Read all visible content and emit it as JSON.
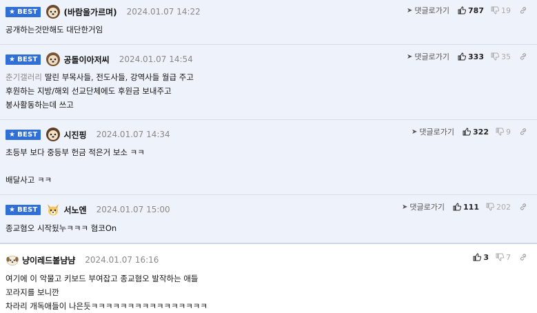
{
  "best_label": "BEST",
  "reply_label": "댓글로가기",
  "comments": [
    {
      "nickname": "(바람을가르며)",
      "date": "2024.01.07 14:22",
      "up": "787",
      "down": "19",
      "lines": [
        "공개하는것만해도 대단한거임"
      ]
    },
    {
      "nickname": "공돌이아저씨",
      "date": "2024.01.07 14:54",
      "up": "333",
      "down": "35",
      "prefix": "춘기갤러리",
      "lines": [
        "딸린 부목사들, 전도사들, 강역사들 월급 주고",
        "후원하는 지방/해외 선교단체에도 후원금 보내주고",
        "봉사활동하는데 쓰고"
      ]
    },
    {
      "nickname": "시진핑",
      "date": "2024.01.07 14:34",
      "up": "322",
      "down": "9",
      "lines": [
        "초등부 보다 중등부 헌금 적은거 보소 ㅋㅋ",
        "",
        "배달사고 ㅋㅋ"
      ]
    },
    {
      "nickname": "서노엔",
      "date": "2024.01.07 15:00",
      "up": "111",
      "down": "202",
      "lines": [
        "종교혐오 시작됬누ㅋㅋㅋ 혐코On"
      ]
    },
    {
      "nickname": "냥이레드볼냠냠",
      "date": "2024.01.07 16:16",
      "up": "3",
      "down": "7",
      "lines": [
        "여기에 이 악물고 키보드 부여잡고 종교혐오 발작하는 애들",
        "꼬라지를 보니깐",
        "차라리 개독애들이 나은듯ㅋㅋㅋㅋㅋㅋㅋㅋㅋㅋㅋㅋㅋㅋㅋㅋ"
      ]
    }
  ],
  "colors": {
    "best_badge": "#2f6fd6",
    "best_bg": "#eef3fb"
  }
}
